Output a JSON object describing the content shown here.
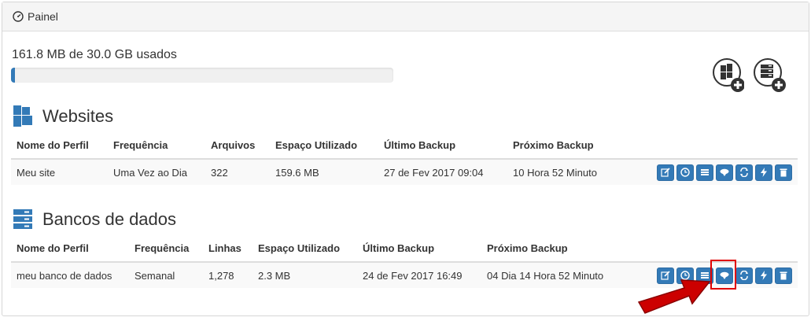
{
  "panel": {
    "title": "Painel"
  },
  "storage": {
    "usage_text": "161.8 MB de 30.0 GB usados",
    "fraction_used": 0.005
  },
  "add_buttons": [
    {
      "name": "add-website-button",
      "icon": "website-plus-icon"
    },
    {
      "name": "add-database-button",
      "icon": "database-plus-icon"
    }
  ],
  "websites": {
    "title": "Websites",
    "columns": [
      "Nome do Perfil",
      "Frequência",
      "Arquivos",
      "Espaço Utilizado",
      "Último Backup",
      "Próximo Backup"
    ],
    "rows": [
      [
        "Meu site",
        "Uma Vez ao Dia",
        "322",
        "159.6 MB",
        "27 de Fev 2017 09:04",
        "10 Hora 52 Minuto"
      ]
    ]
  },
  "databases": {
    "title": "Bancos de dados",
    "columns": [
      "Nome do Perfil",
      "Frequência",
      "Linhas",
      "Espaço Utilizado",
      "Último Backup",
      "Próximo Backup"
    ],
    "rows": [
      [
        "meu banco de dados",
        "Semanal",
        "1,278",
        "2.3 MB",
        "24 de Fev 2017 16:49",
        "04 Dia 14 Hora 52 Minuto"
      ]
    ]
  },
  "action_icons": [
    "edit-icon",
    "clock-icon",
    "list-icon",
    "cloud-download-icon",
    "refresh-icon",
    "bolt-icon",
    "trash-icon"
  ],
  "colors": {
    "primary": "#337ab7",
    "annotation": "#cc0000"
  }
}
